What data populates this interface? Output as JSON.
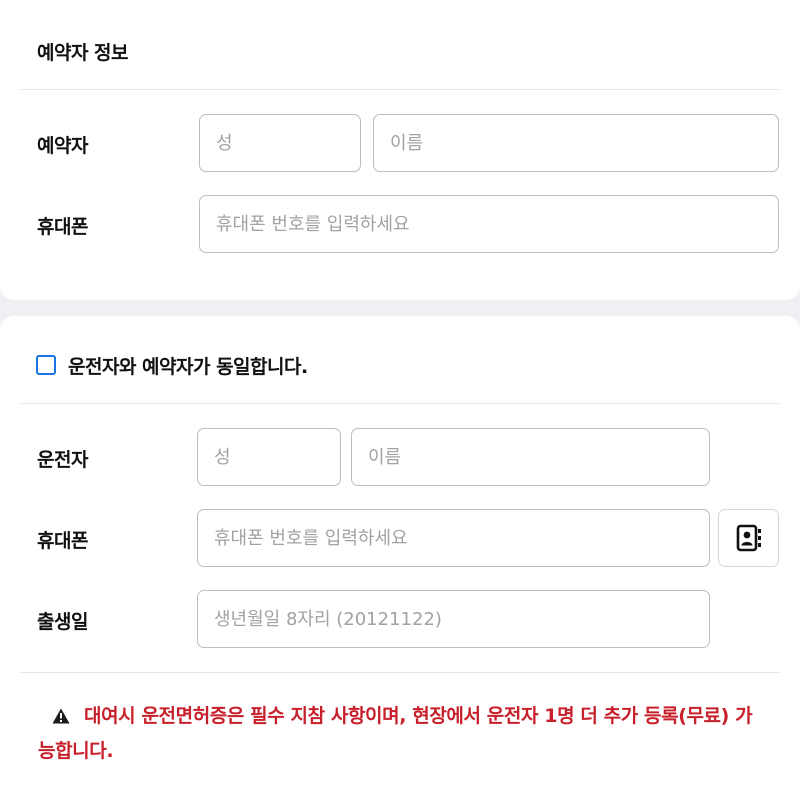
{
  "reserver_section": {
    "title": "예약자 정보",
    "name_label": "예약자",
    "last_name_placeholder": "성",
    "first_name_placeholder": "이름",
    "phone_label": "휴대폰",
    "phone_placeholder": "휴대폰 번호를 입력하세요"
  },
  "driver_section": {
    "same_checkbox_label": "운전자와 예약자가 동일합니다.",
    "same_checkbox_checked": false,
    "name_label": "운전자",
    "last_name_placeholder": "성",
    "first_name_placeholder": "이름",
    "phone_label": "휴대폰",
    "phone_placeholder": "휴대폰 번호를 입력하세요",
    "contact_icon": "contact-book-icon",
    "birth_label": "출생일",
    "birth_placeholder": "생년월일 8자리 (20121122)",
    "notice_icon": "warning-icon",
    "notice_text": "대여시 운전면허증은 필수 지참 사항이며, 현장에서 운전자 1명 더 추가 등록(무료) 가능합니다."
  },
  "colors": {
    "accent": "#1a73e8",
    "warning": "#c8202b",
    "border": "#bdbdbd",
    "background": "#eef0f3"
  }
}
